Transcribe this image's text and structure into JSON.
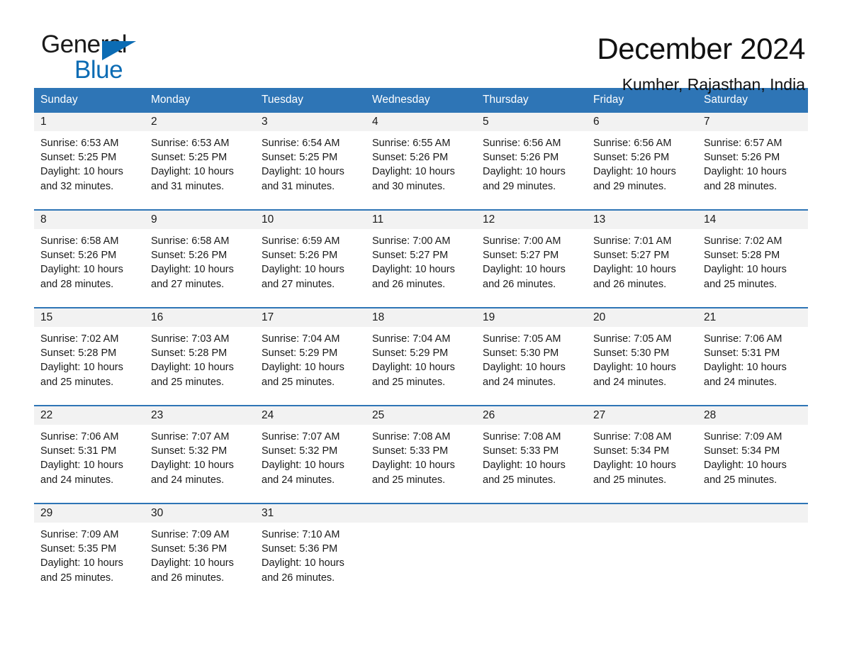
{
  "brand": {
    "name_top": "General",
    "name_bottom": "Blue",
    "accent_color": "#0c6cb4",
    "triangle_icon": "brand-triangle-icon"
  },
  "header": {
    "title": "December 2024",
    "subtitle": "Kumher, Rajasthan, India"
  },
  "calendar": {
    "header_bg": "#2e75b6",
    "header_text_color": "#ffffff",
    "day_band_bg": "#f2f2f2",
    "weekdays": [
      "Sunday",
      "Monday",
      "Tuesday",
      "Wednesday",
      "Thursday",
      "Friday",
      "Saturday"
    ],
    "weeks": [
      [
        {
          "day": "1",
          "sunrise": "Sunrise: 6:53 AM",
          "sunset": "Sunset: 5:25 PM",
          "daylight_1": "Daylight: 10 hours",
          "daylight_2": "and 32 minutes."
        },
        {
          "day": "2",
          "sunrise": "Sunrise: 6:53 AM",
          "sunset": "Sunset: 5:25 PM",
          "daylight_1": "Daylight: 10 hours",
          "daylight_2": "and 31 minutes."
        },
        {
          "day": "3",
          "sunrise": "Sunrise: 6:54 AM",
          "sunset": "Sunset: 5:25 PM",
          "daylight_1": "Daylight: 10 hours",
          "daylight_2": "and 31 minutes."
        },
        {
          "day": "4",
          "sunrise": "Sunrise: 6:55 AM",
          "sunset": "Sunset: 5:26 PM",
          "daylight_1": "Daylight: 10 hours",
          "daylight_2": "and 30 minutes."
        },
        {
          "day": "5",
          "sunrise": "Sunrise: 6:56 AM",
          "sunset": "Sunset: 5:26 PM",
          "daylight_1": "Daylight: 10 hours",
          "daylight_2": "and 29 minutes."
        },
        {
          "day": "6",
          "sunrise": "Sunrise: 6:56 AM",
          "sunset": "Sunset: 5:26 PM",
          "daylight_1": "Daylight: 10 hours",
          "daylight_2": "and 29 minutes."
        },
        {
          "day": "7",
          "sunrise": "Sunrise: 6:57 AM",
          "sunset": "Sunset: 5:26 PM",
          "daylight_1": "Daylight: 10 hours",
          "daylight_2": "and 28 minutes."
        }
      ],
      [
        {
          "day": "8",
          "sunrise": "Sunrise: 6:58 AM",
          "sunset": "Sunset: 5:26 PM",
          "daylight_1": "Daylight: 10 hours",
          "daylight_2": "and 28 minutes."
        },
        {
          "day": "9",
          "sunrise": "Sunrise: 6:58 AM",
          "sunset": "Sunset: 5:26 PM",
          "daylight_1": "Daylight: 10 hours",
          "daylight_2": "and 27 minutes."
        },
        {
          "day": "10",
          "sunrise": "Sunrise: 6:59 AM",
          "sunset": "Sunset: 5:26 PM",
          "daylight_1": "Daylight: 10 hours",
          "daylight_2": "and 27 minutes."
        },
        {
          "day": "11",
          "sunrise": "Sunrise: 7:00 AM",
          "sunset": "Sunset: 5:27 PM",
          "daylight_1": "Daylight: 10 hours",
          "daylight_2": "and 26 minutes."
        },
        {
          "day": "12",
          "sunrise": "Sunrise: 7:00 AM",
          "sunset": "Sunset: 5:27 PM",
          "daylight_1": "Daylight: 10 hours",
          "daylight_2": "and 26 minutes."
        },
        {
          "day": "13",
          "sunrise": "Sunrise: 7:01 AM",
          "sunset": "Sunset: 5:27 PM",
          "daylight_1": "Daylight: 10 hours",
          "daylight_2": "and 26 minutes."
        },
        {
          "day": "14",
          "sunrise": "Sunrise: 7:02 AM",
          "sunset": "Sunset: 5:28 PM",
          "daylight_1": "Daylight: 10 hours",
          "daylight_2": "and 25 minutes."
        }
      ],
      [
        {
          "day": "15",
          "sunrise": "Sunrise: 7:02 AM",
          "sunset": "Sunset: 5:28 PM",
          "daylight_1": "Daylight: 10 hours",
          "daylight_2": "and 25 minutes."
        },
        {
          "day": "16",
          "sunrise": "Sunrise: 7:03 AM",
          "sunset": "Sunset: 5:28 PM",
          "daylight_1": "Daylight: 10 hours",
          "daylight_2": "and 25 minutes."
        },
        {
          "day": "17",
          "sunrise": "Sunrise: 7:04 AM",
          "sunset": "Sunset: 5:29 PM",
          "daylight_1": "Daylight: 10 hours",
          "daylight_2": "and 25 minutes."
        },
        {
          "day": "18",
          "sunrise": "Sunrise: 7:04 AM",
          "sunset": "Sunset: 5:29 PM",
          "daylight_1": "Daylight: 10 hours",
          "daylight_2": "and 25 minutes."
        },
        {
          "day": "19",
          "sunrise": "Sunrise: 7:05 AM",
          "sunset": "Sunset: 5:30 PM",
          "daylight_1": "Daylight: 10 hours",
          "daylight_2": "and 24 minutes."
        },
        {
          "day": "20",
          "sunrise": "Sunrise: 7:05 AM",
          "sunset": "Sunset: 5:30 PM",
          "daylight_1": "Daylight: 10 hours",
          "daylight_2": "and 24 minutes."
        },
        {
          "day": "21",
          "sunrise": "Sunrise: 7:06 AM",
          "sunset": "Sunset: 5:31 PM",
          "daylight_1": "Daylight: 10 hours",
          "daylight_2": "and 24 minutes."
        }
      ],
      [
        {
          "day": "22",
          "sunrise": "Sunrise: 7:06 AM",
          "sunset": "Sunset: 5:31 PM",
          "daylight_1": "Daylight: 10 hours",
          "daylight_2": "and 24 minutes."
        },
        {
          "day": "23",
          "sunrise": "Sunrise: 7:07 AM",
          "sunset": "Sunset: 5:32 PM",
          "daylight_1": "Daylight: 10 hours",
          "daylight_2": "and 24 minutes."
        },
        {
          "day": "24",
          "sunrise": "Sunrise: 7:07 AM",
          "sunset": "Sunset: 5:32 PM",
          "daylight_1": "Daylight: 10 hours",
          "daylight_2": "and 24 minutes."
        },
        {
          "day": "25",
          "sunrise": "Sunrise: 7:08 AM",
          "sunset": "Sunset: 5:33 PM",
          "daylight_1": "Daylight: 10 hours",
          "daylight_2": "and 25 minutes."
        },
        {
          "day": "26",
          "sunrise": "Sunrise: 7:08 AM",
          "sunset": "Sunset: 5:33 PM",
          "daylight_1": "Daylight: 10 hours",
          "daylight_2": "and 25 minutes."
        },
        {
          "day": "27",
          "sunrise": "Sunrise: 7:08 AM",
          "sunset": "Sunset: 5:34 PM",
          "daylight_1": "Daylight: 10 hours",
          "daylight_2": "and 25 minutes."
        },
        {
          "day": "28",
          "sunrise": "Sunrise: 7:09 AM",
          "sunset": "Sunset: 5:34 PM",
          "daylight_1": "Daylight: 10 hours",
          "daylight_2": "and 25 minutes."
        }
      ],
      [
        {
          "day": "29",
          "sunrise": "Sunrise: 7:09 AM",
          "sunset": "Sunset: 5:35 PM",
          "daylight_1": "Daylight: 10 hours",
          "daylight_2": "and 25 minutes."
        },
        {
          "day": "30",
          "sunrise": "Sunrise: 7:09 AM",
          "sunset": "Sunset: 5:36 PM",
          "daylight_1": "Daylight: 10 hours",
          "daylight_2": "and 26 minutes."
        },
        {
          "day": "31",
          "sunrise": "Sunrise: 7:10 AM",
          "sunset": "Sunset: 5:36 PM",
          "daylight_1": "Daylight: 10 hours",
          "daylight_2": "and 26 minutes."
        },
        {
          "day": "",
          "sunrise": "",
          "sunset": "",
          "daylight_1": "",
          "daylight_2": ""
        },
        {
          "day": "",
          "sunrise": "",
          "sunset": "",
          "daylight_1": "",
          "daylight_2": ""
        },
        {
          "day": "",
          "sunrise": "",
          "sunset": "",
          "daylight_1": "",
          "daylight_2": ""
        },
        {
          "day": "",
          "sunrise": "",
          "sunset": "",
          "daylight_1": "",
          "daylight_2": ""
        }
      ]
    ]
  }
}
